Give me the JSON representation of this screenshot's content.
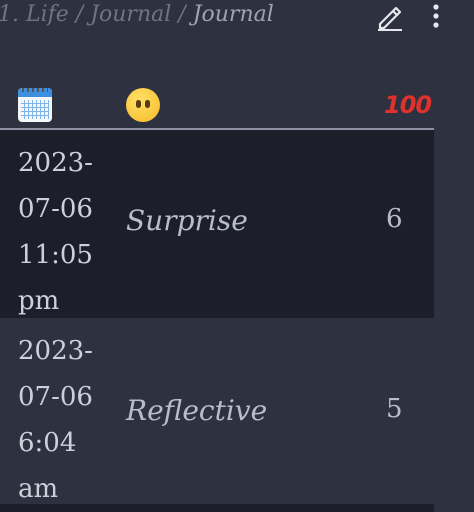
{
  "breadcrumb": {
    "part1": "1. Life",
    "sep": " / ",
    "part2": "Journal",
    "current": "Journal"
  },
  "icons": {
    "edit": "pencil-icon",
    "more": "more-vertical-icon",
    "date_column": "calendar-icon",
    "mood_column": "face-without-mouth-icon",
    "score_column": "hundred-points-icon"
  },
  "table": {
    "score_header_glyph": "100",
    "rows": [
      {
        "date": "2023-07-06 11:05 pm",
        "date_lines": [
          "2023-",
          "07-06",
          "11:05",
          "pm"
        ],
        "mood": "Surprise",
        "score": "6"
      },
      {
        "date": "2023-07-06 6:04 am",
        "date_lines": [
          "2023-",
          "07-06",
          "6:04",
          "am"
        ],
        "mood": "Reflective",
        "score": "5"
      }
    ]
  },
  "colors": {
    "background": "#2e3140",
    "row_highlight": "#1c1e2a",
    "score_icon": "#e0322c"
  }
}
